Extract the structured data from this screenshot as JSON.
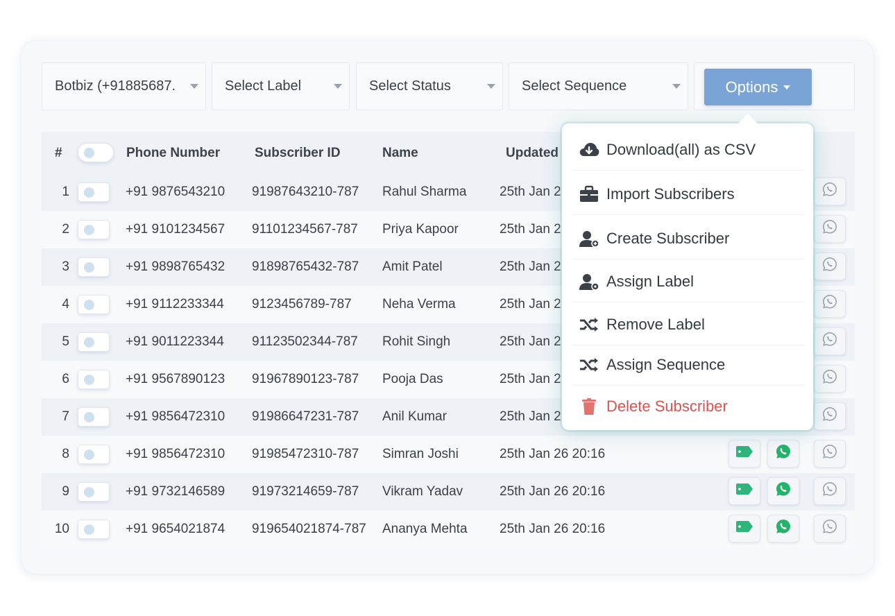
{
  "filters": {
    "account": "Botbiz (+91885687.",
    "label": "Select Label",
    "status": "Select Status",
    "sequence": "Select Sequence",
    "options_button": "Options"
  },
  "table": {
    "headers": {
      "num": "#",
      "phone": "Phone Number",
      "subscriber_id": "Subscriber ID",
      "name": "Name",
      "updated": "Updated"
    },
    "rows": [
      {
        "num": "1",
        "phone": "+91 9876543210",
        "id": "91987643210-787",
        "name": "Rahul Sharma",
        "updated": "25th Jan 2"
      },
      {
        "num": "2",
        "phone": "+91 9101234567",
        "id": "91101234567-787",
        "name": "Priya Kapoor",
        "updated": "25th Jan 2"
      },
      {
        "num": "3",
        "phone": "+91 9898765432",
        "id": "91898765432-787",
        "name": "Amit Patel",
        "updated": "25th Jan 2"
      },
      {
        "num": "4",
        "phone": "+91 9112233344",
        "id": "9123456789-787",
        "name": "Neha Verma",
        "updated": "25th Jan 2"
      },
      {
        "num": "5",
        "phone": "+91 9011223344",
        "id": "91123502344-787",
        "name": "Rohit Singh",
        "updated": "25th Jan 2"
      },
      {
        "num": "6",
        "phone": "+91 9567890123",
        "id": "91967890123-787",
        "name": "Pooja Das",
        "updated": "25th Jan 2"
      },
      {
        "num": "7",
        "phone": "+91 9856472310",
        "id": "91986647231-787",
        "name": "Anil Kumar",
        "updated": "25th Jan 2"
      },
      {
        "num": "8",
        "phone": "+91 9856472310",
        "id": "91985472310-787",
        "name": "Simran Joshi",
        "updated": "25th Jan 26 20:16"
      },
      {
        "num": "9",
        "phone": "+91 9732146589",
        "id": "91973214659-787",
        "name": "Vikram Yadav",
        "updated": "25th Jan 26 20:16"
      },
      {
        "num": "10",
        "phone": "+91 9654021874",
        "id": "919654021874-787",
        "name": "Ananya Mehta",
        "updated": "25th Jan 26 20:16"
      }
    ]
  },
  "menu": {
    "items": [
      {
        "label": "Download(all) as CSV",
        "icon": "cloud-download-icon"
      },
      {
        "label": "Import Subscribers",
        "icon": "briefcase-icon"
      },
      {
        "label": "Create Subscriber",
        "icon": "user-plus-icon"
      },
      {
        "label": "Assign Label",
        "icon": "user-tag-icon"
      },
      {
        "label": "Remove Label",
        "icon": "shuffle-icon"
      },
      {
        "label": "Assign Sequence",
        "icon": "shuffle-icon"
      },
      {
        "label": "Delete Subscriber",
        "icon": "trash-icon"
      }
    ]
  },
  "colors": {
    "options_button": "#7aa4d6",
    "tag_icon": "#2fb47c",
    "whatsapp_icon": "#24b36b",
    "delete": "#d9534f"
  }
}
